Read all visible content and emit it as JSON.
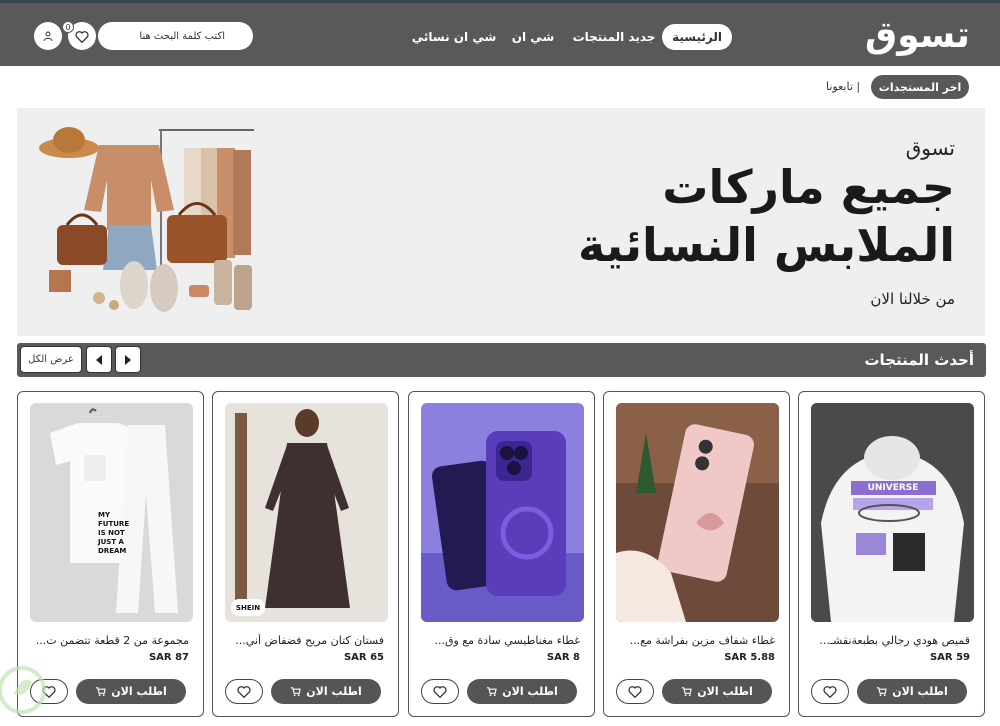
{
  "header": {
    "logo_text": "تسوق",
    "nav": [
      {
        "label": "الرئيسية"
      },
      {
        "label": "جديد المنتجات"
      },
      {
        "label": "شي ان"
      },
      {
        "label": "شي ان نسائي"
      }
    ],
    "search_placeholder": "اكتب كلمة البحث هنا",
    "wishlist_count": "0"
  },
  "news": {
    "pill_label": "اخر المستجدات",
    "follow_label": "تابعونا |"
  },
  "banner": {
    "small_text": "تسوق",
    "headline_line1": "جميع ماركات",
    "headline_line2": "الملابس النسائية",
    "subtext": "من خلالنا الان"
  },
  "section": {
    "title": "أحدث المنتجات",
    "view_all_label": "عرض الكل"
  },
  "products": [
    {
      "title": "قميص هودي رجالي بطبعةنقشات",
      "title_shown": "قميص هودي رجالي بطبعةنقشـ...",
      "price": "SAR 59",
      "order_label": "اطلب الان"
    },
    {
      "title": "غطاء شفاف مزين بفراشة مع",
      "title_shown": "غطاء شفاف مزين بفراشة مع...",
      "price": "SAR 5.88",
      "order_label": "اطلب الان"
    },
    {
      "title": "غطاء مغناطيسي سادة مع وقاء",
      "title_shown": "غطاء مغناطيسي سادة مع وق...",
      "price": "SAR 8",
      "order_label": "اطلب الان"
    },
    {
      "title": "فستان كتان مريح فضفاض أنيق",
      "title_shown": "فستان كتان مريح فضفاض أني...",
      "price": "SAR 65",
      "order_label": "اطلب الان"
    },
    {
      "title": "مجموعة من 2 قطعة تتضمن تيشيرت",
      "title_shown": "مجموعة من 2 قطعة تتضمن ت...",
      "price": "SAR 87",
      "order_label": "اطلب الان"
    }
  ],
  "image_text": {
    "hoodie": "UNIVERSE",
    "shein": "SHEIN",
    "tshirt": "MY FUTURE IS NOT JUST A DREAM"
  },
  "colors": {
    "header_bg": "#595959",
    "accent_dark": "#555555",
    "banner_bg": "#efefef"
  },
  "icons": [
    "user-icon",
    "heart-icon",
    "cart-icon",
    "chevron-left-icon",
    "chevron-right-icon"
  ]
}
